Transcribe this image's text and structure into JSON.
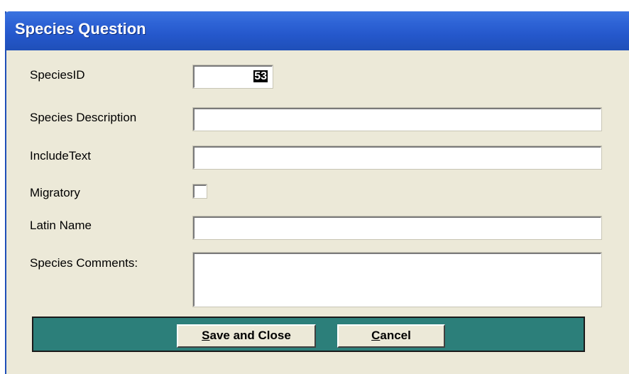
{
  "window": {
    "title": "Species Question"
  },
  "form": {
    "species_id_label": "SpeciesID",
    "species_id_value": "53",
    "species_description_label": "Species Description",
    "species_description_value": "",
    "include_text_label": "IncludeText",
    "include_text_value": "",
    "migratory_label": "Migratory",
    "migratory_checked": false,
    "latin_name_label": "Latin Name",
    "latin_name_value": "",
    "species_comments_label": "Species Comments:",
    "species_comments_value": ""
  },
  "buttons": {
    "save_mnemonic": "S",
    "save_rest": "ave and Close",
    "cancel_mnemonic": "C",
    "cancel_rest": "ancel"
  },
  "colors": {
    "titlebar": "#2558cc",
    "window_bg": "#ece9d8",
    "button_bar": "#2c7f7a"
  }
}
